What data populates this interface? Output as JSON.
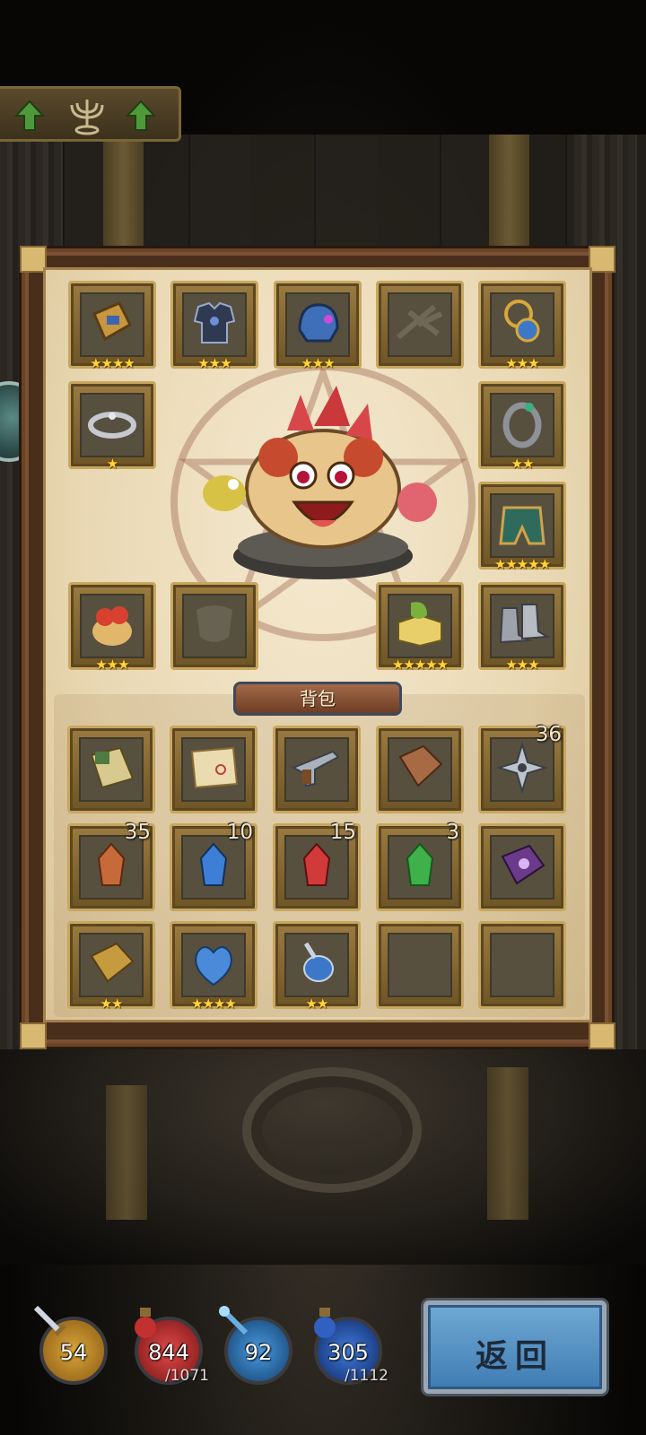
{
  "equipment": {
    "slots": [
      {
        "name": "bracer",
        "stars": "★★★★"
      },
      {
        "name": "chest-armor",
        "stars": "★★★"
      },
      {
        "name": "helmet",
        "stars": "★★★"
      },
      {
        "name": "crossbow-empty",
        "stars": ""
      },
      {
        "name": "amulet",
        "stars": "★★★"
      },
      {
        "name": "ring-left",
        "stars": "★"
      },
      {
        "name": "ring-right",
        "stars": "★★"
      },
      {
        "name": "green-armor",
        "stars": "★★★★★"
      },
      {
        "name": "pet-mushroom",
        "stars": "★★★"
      },
      {
        "name": "mask-empty",
        "stars": ""
      },
      {
        "name": "green-scroll-book",
        "stars": "★★★★★"
      },
      {
        "name": "boots",
        "stars": "★★★"
      }
    ]
  },
  "backpack": {
    "title": "背包",
    "items": [
      {
        "name": "green-map",
        "count": "",
        "stars": ""
      },
      {
        "name": "treasure-map",
        "count": "",
        "stars": ""
      },
      {
        "name": "pistol",
        "count": "",
        "stars": ""
      },
      {
        "name": "recipe-book",
        "count": "",
        "stars": ""
      },
      {
        "name": "shuriken",
        "count": "36",
        "stars": ""
      },
      {
        "name": "orange-crystal",
        "count": "35",
        "stars": ""
      },
      {
        "name": "blue-crystal",
        "count": "10",
        "stars": ""
      },
      {
        "name": "red-crystal",
        "count": "15",
        "stars": ""
      },
      {
        "name": "green-crystal",
        "count": "3",
        "stars": ""
      },
      {
        "name": "purple-tome",
        "count": "",
        "stars": ""
      },
      {
        "name": "gold-book",
        "count": "",
        "stars": "★★"
      },
      {
        "name": "blue-heart",
        "count": "",
        "stars": "★★★★"
      },
      {
        "name": "blue-potion",
        "count": "",
        "stars": "★★"
      },
      {
        "name": "empty",
        "count": "",
        "stars": ""
      },
      {
        "name": "empty",
        "count": "",
        "stars": ""
      }
    ]
  },
  "stats": {
    "attack": "54",
    "hp": "844",
    "hp_max": "/1071",
    "defense": "92",
    "mana": "305",
    "mana_max": "/1112"
  },
  "back_button": "返回"
}
